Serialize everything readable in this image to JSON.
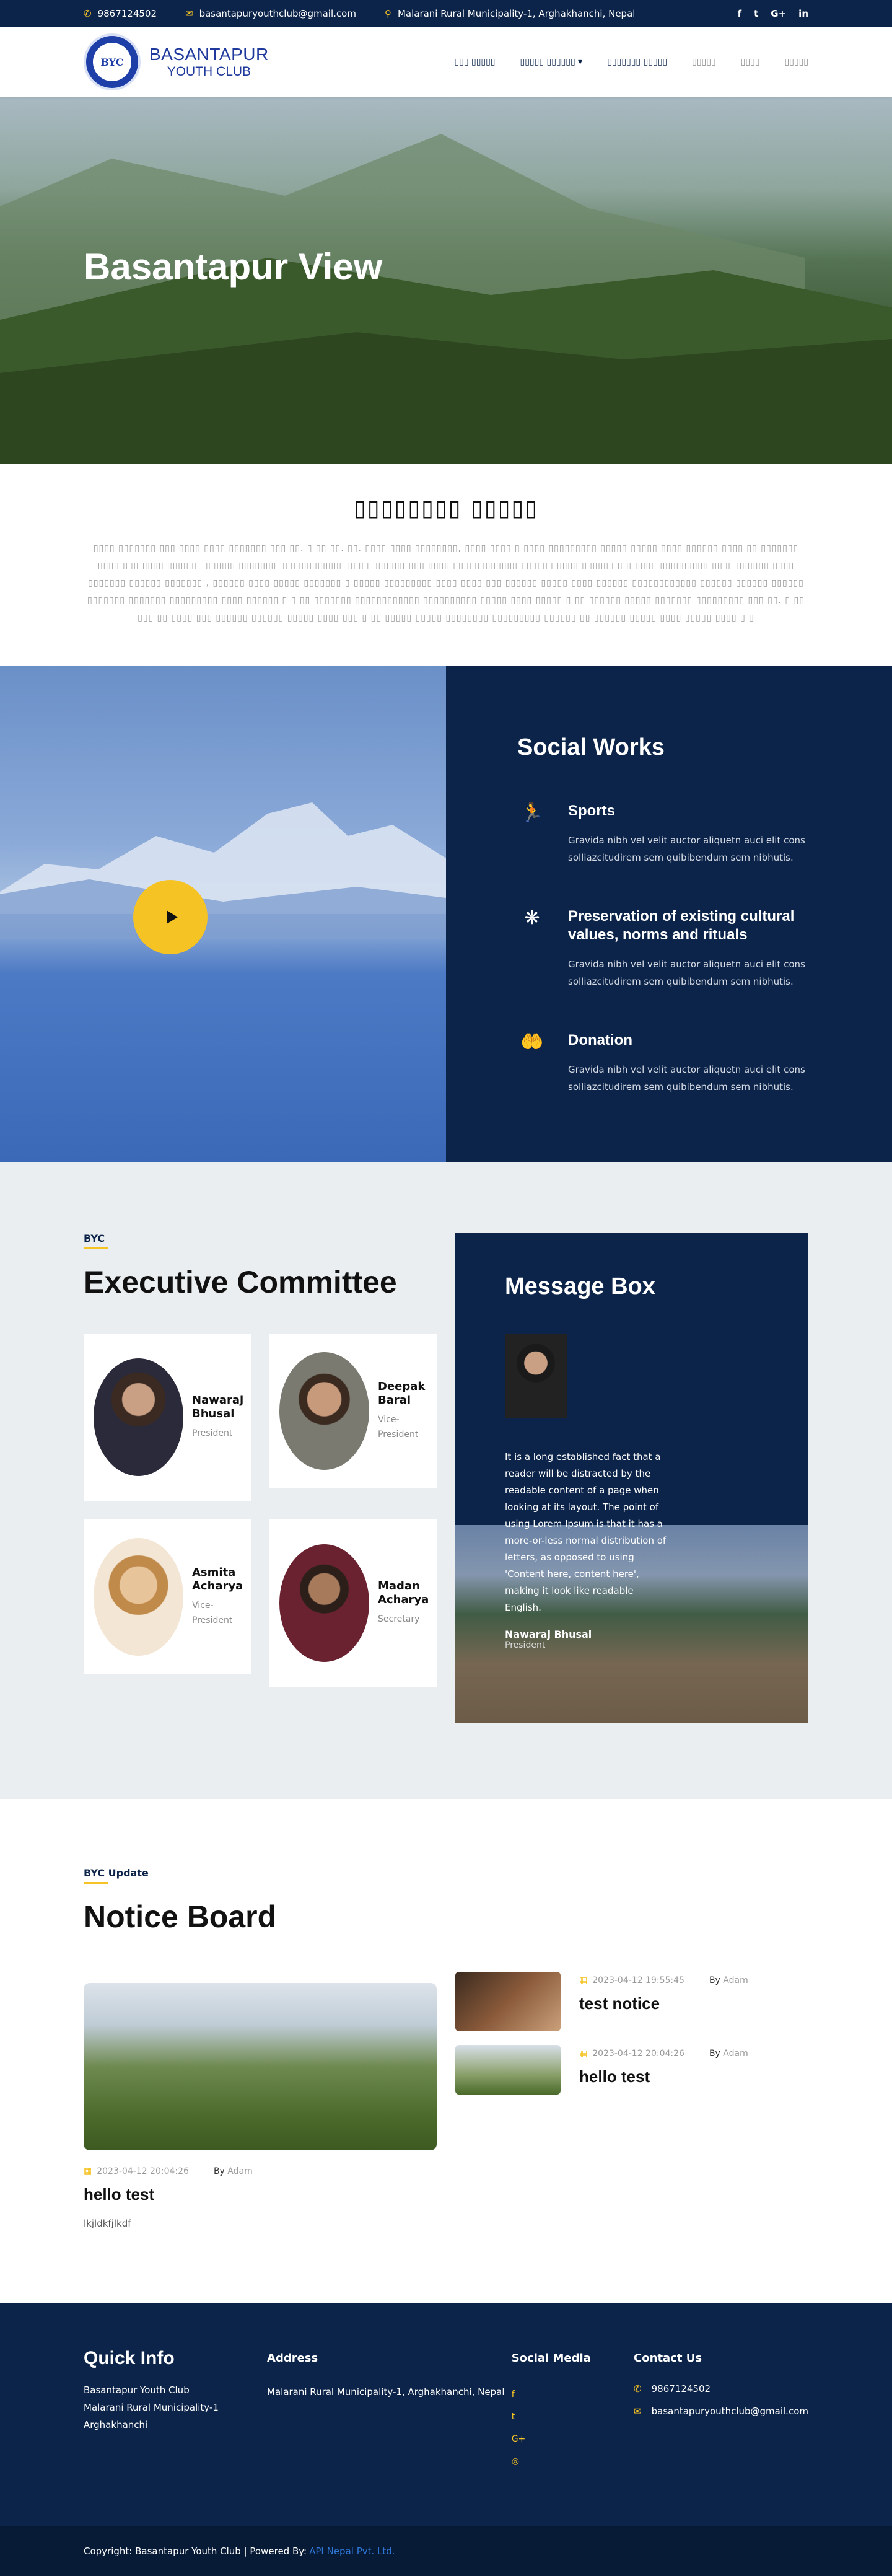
{
  "topbar": {
    "phone": "9867124502",
    "email": "basantapuryouthclub@gmail.com",
    "address": "Malarani Rural Municipality-1, Arghakhanchi, Nepal",
    "social": [
      "f",
      "t",
      "G+",
      "in"
    ]
  },
  "logo": {
    "badge": "BYC",
    "line1": "BASANTAPUR",
    "line2": "YOUTH CLUB"
  },
  "nav": {
    "items": [
      "▯▯▯ ▯▯▯▯▯",
      "▯▯▯▯▯ ▯▯▯▯▯▯",
      "▯▯▯▯▯▯▯ ▯▯▯▯▯",
      "▯▯▯▯▯",
      "▯▯▯▯",
      "▯▯▯▯▯"
    ],
    "dropdown_caret": "▾"
  },
  "hero": {
    "title": "Basantapur View"
  },
  "about": {
    "title": "▯▯▯▯▯▯▯▯ ▯▯▯▯▯",
    "body": "▯▯▯▯ ▯▯▯▯▯▯▯ ▯▯▯ ▯▯▯▯ ▯▯▯▯ ▯▯▯▯▯▯▯ ▯▯▯ ▯▯. ▯ ▯▯ ▯▯. ▯▯. ▯▯▯▯ ▯▯▯▯ ▯▯▯▯▯▯▯▯, ▯▯▯▯ ▯▯▯▯ ▯ ▯▯▯▯ ▯▯▯▯▯▯▯▯▯ ▯▯▯▯▯ ▯▯▯▯▯ ▯▯▯▯ ▯▯▯▯▯▯ ▯▯▯▯ ▯▯ ▯▯▯▯▯▯▯ ▯▯▯▯ ▯▯▯ ▯▯▯▯ ▯▯▯▯▯▯ ▯▯▯▯▯▯ ▯▯▯▯▯▯▯ ▯▯▯▯▯▯▯▯▯▯▯▯ ▯▯▯▯ ▯▯▯▯▯▯ ▯▯▯ ▯▯▯▯ ▯▯▯▯▯▯▯▯▯▯▯▯ ▯▯▯▯▯▯ ▯▯▯▯ ▯▯▯▯▯▯ ▯ ▯ ▯▯▯▯ ▯▯▯▯▯▯▯▯▯ ▯▯▯▯ ▯▯▯▯▯▯ ▯▯▯▯ ▯▯▯▯▯▯▯ ▯▯▯▯▯▯ ▯▯▯▯▯▯▯ , ▯▯▯▯▯▯ ▯▯▯▯ ▯▯▯▯▯ ▯▯▯▯▯▯▯ ▯ ▯▯▯▯▯ ▯▯▯▯▯▯▯▯▯ ▯▯▯▯ ▯▯▯▯ ▯▯▯ ▯▯▯▯▯▯ ▯▯▯▯▯ ▯▯▯▯ ▯▯▯▯▯▯ ▯▯▯▯▯▯▯▯▯▯▯▯ ▯▯▯▯▯▯ ▯▯▯▯▯▯ ▯▯▯▯▯▯ ▯▯▯▯▯▯▯ ▯▯▯▯▯▯▯ ▯▯▯▯▯▯▯▯▯ ▯▯▯▯ ▯▯▯▯▯▯ ▯ ▯ ▯▯ ▯▯▯▯▯▯▯ ▯▯▯▯▯▯▯▯▯▯▯▯ ▯▯▯▯▯▯▯▯▯▯ ▯▯▯▯▯ ▯▯▯▯ ▯▯▯▯▯ ▯ ▯▯ ▯▯▯▯▯▯ ▯▯▯▯▯ ▯▯▯▯▯▯▯ ▯▯▯▯▯▯▯▯▯ ▯▯▯ ▯▯. ▯ ▯▯ ▯▯▯ ▯▯ ▯▯▯▯ ▯▯▯ ▯▯▯▯▯▯ ▯▯▯▯▯▯ ▯▯▯▯▯ ▯▯▯▯ ▯▯▯ ▯ ▯▯ ▯▯▯▯▯ ▯▯▯▯▯ ▯▯▯▯▯▯▯▯ ▯▯▯▯▯▯▯▯▯ ▯▯▯▯▯▯ ▯▯ ▯▯▯▯▯▯ ▯▯▯▯▯ ▯▯▯▯ ▯▯▯▯▯ ▯▯▯▯ ▯ ▯"
  },
  "works": {
    "title": "Social Works",
    "items": [
      {
        "icon": "runner-icon",
        "glyph": "🏃",
        "title": "Sports",
        "text": "Gravida nibh vel velit auctor aliquetn auci elit cons solliazcitudirem sem quibibendum sem nibhutis."
      },
      {
        "icon": "culture-icon",
        "glyph": "❋",
        "title": "Preservation of existing cultural values, norms and rituals",
        "text": "Gravida nibh vel velit auctor aliquetn auci elit cons solliazcitudirem sem quibibendum sem nibhutis."
      },
      {
        "icon": "donation-icon",
        "glyph": "🤲",
        "title": "Donation",
        "text": "Gravida nibh vel velit auctor aliquetn auci elit cons solliazcitudirem sem quibibendum sem nibhutis."
      }
    ]
  },
  "committee": {
    "tag": "BYC",
    "title": "Executive Committee",
    "members": [
      {
        "name": "Nawaraj Bhusal",
        "role": "President"
      },
      {
        "name": "Deepak Baral",
        "role": "Vice-President"
      },
      {
        "name": "Asmita Acharya",
        "role": "Vice-President"
      },
      {
        "name": "Madan Acharya",
        "role": "Secretary"
      }
    ],
    "message": {
      "title": "Message Box",
      "text": "It is a long established fact that a reader will be distracted by the readable content of a page when looking at its layout. The point of using Lorem Ipsum is that it has a more-or-less normal distribution of letters, as opposed to using 'Content here, content here', making it look like readable English.",
      "name": "Nawaraj Bhusal",
      "role": "President"
    }
  },
  "notice": {
    "tag": "BYC Update",
    "title": "Notice Board",
    "main": {
      "date": "2023-04-12 20:04:26",
      "by_label": "By",
      "author": "Adam",
      "title": "hello test",
      "body": "lkjldkfjlkdf"
    },
    "side": [
      {
        "date": "2023-04-12 19:55:45",
        "by_label": "By",
        "author": "Adam",
        "title": "test notice"
      },
      {
        "date": "2023-04-12 20:04:26",
        "by_label": "By",
        "author": "Adam",
        "title": "hello test"
      }
    ]
  },
  "footer": {
    "quick_title": "Quick Info",
    "quick_text": "Basantapur Youth Club Malarani Rural Municipality-1 Arghakhanchi",
    "address_title": "Address",
    "address_text": "Malarani Rural Municipality-1, Arghakhanchi, Nepal",
    "social_title": "Social Media",
    "social": [
      "f",
      "t",
      "G+",
      "◎"
    ],
    "contact_title": "Contact Us",
    "phone": "9867124502",
    "email": "basantapuryouthclub@gmail.com"
  },
  "copyright": {
    "text": "Copyright: Basantapur Youth Club | Powered By:",
    "link": "API Nepal Pvt. Ltd."
  },
  "colors": {
    "navy": "#0c2449",
    "accent": "#f6c324",
    "link": "#2f78d8"
  }
}
